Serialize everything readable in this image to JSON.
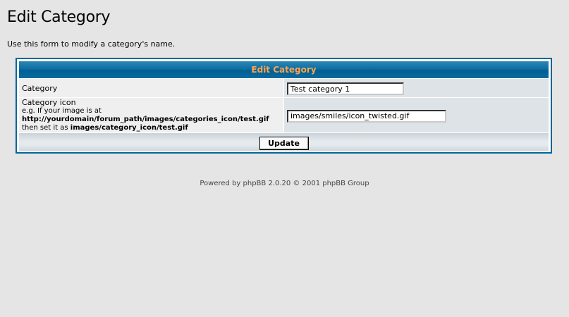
{
  "page": {
    "title": "Edit Category",
    "intro": "Use this form to modify a category's name."
  },
  "form": {
    "header": "Edit Category",
    "category": {
      "label": "Category",
      "value": "Test category 1"
    },
    "icon": {
      "label": "Category icon",
      "hint_prefix": "e.g. If your image is at ",
      "hint_path1": "http://yourdomain/forum_path/images/categories_icon/test.gif",
      "hint_middle": "then set it as ",
      "hint_path2": "images/category_icon/test.gif",
      "value": "images/smiles/icon_twisted.gif"
    },
    "submit_label": "Update"
  },
  "footer": {
    "powered": "Powered by phpBB 2.0.20 © 2001 phpBB Group"
  },
  "colors": {
    "header_bg": "#006699",
    "header_text": "#ffa34f",
    "label_bg": "#efefef",
    "value_bg": "#dee3e7",
    "page_bg": "#e5e5e5"
  }
}
